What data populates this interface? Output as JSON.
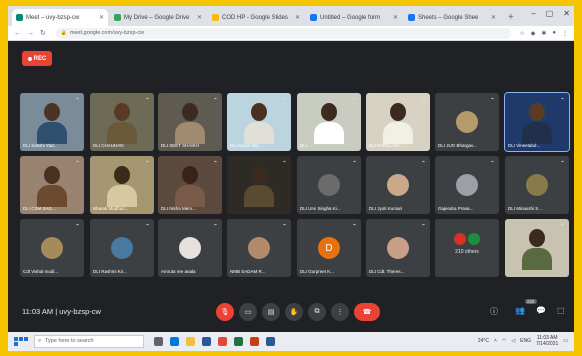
{
  "browser": {
    "tabs": [
      {
        "label": "Meet – uvy-bzsp-cw",
        "fav": "#00897b",
        "active": true
      },
      {
        "label": "My Drive – Google Drive",
        "fav": "#34a853",
        "active": false
      },
      {
        "label": "COD HP - Google Slides",
        "fav": "#fbbc04",
        "active": false
      },
      {
        "label": "Untitled – Google form",
        "fav": "#1a73e8",
        "active": false
      },
      {
        "label": "Sheets – Google Shee",
        "fav": "#1a73e8",
        "active": false
      }
    ],
    "new_tab": "+",
    "url": "meet.google.com/uvy-bzsp-cw"
  },
  "meet": {
    "rec_label": "REC",
    "tiles": [
      {
        "name": "DLI Sakshi Yad...",
        "type": "video",
        "bg": "#7a8c9a",
        "head": "#4a3426",
        "body": "#2f4f6f"
      },
      {
        "name": "DLI CHAUHAN",
        "type": "video",
        "bg": "#6d6a55",
        "head": "#5a3a24",
        "body": "#6b5a3a"
      },
      {
        "name": "DLI SEET SHAIKH",
        "type": "video",
        "bg": "#5f5a52",
        "head": "#3a2a20",
        "body": "#a08a70"
      },
      {
        "name": "DLI Karan Ma...",
        "type": "video",
        "bg": "#bcd4e0",
        "head": "#4a3020",
        "body": "#e0e0d8"
      },
      {
        "name": "DLI ...",
        "type": "video",
        "bg": "#c9ccc0",
        "head": "#3e2a1e",
        "body": "#ffffff"
      },
      {
        "name": "DLI PARUL MA...",
        "type": "video",
        "bg": "#d8d2c2",
        "head": "#3b2a1f",
        "body": "#f2efe6"
      },
      {
        "name": "DLI JUO Bhargav...",
        "type": "avatar",
        "avatar_bg": "#b59a6a",
        "initial": ""
      },
      {
        "name": "DLI Vineetabd...",
        "type": "video",
        "bg": "#1f3a6a",
        "head": "#5a3c26",
        "body": "#20304a",
        "highlight": true
      },
      {
        "name": "DLI CSM SAG...",
        "type": "video",
        "bg": "#9a8270",
        "head": "#4a3020",
        "body": "#6b4a30"
      },
      {
        "name": "Bharati Madhuri...",
        "type": "video",
        "bg": "#a59570",
        "head": "#3a2a1c",
        "body": "#d8c8a0"
      },
      {
        "name": "DLI Nisha Mem...",
        "type": "video",
        "bg": "#5d4a3e",
        "head": "#3a2218",
        "body": "#7a5a48"
      },
      {
        "name": "",
        "type": "video",
        "bg": "#2e2a26",
        "head": "#3b2a20",
        "body": "#5a4a30"
      },
      {
        "name": "DLI Urvi Singha Ki...",
        "type": "avatar",
        "avatar_bg": "#6b6b6b",
        "initial": ""
      },
      {
        "name": "DLI Jyoti Kumari",
        "type": "avatar",
        "avatar_bg": "#c9a98a",
        "initial": ""
      },
      {
        "name": "Gajendra Prasa...",
        "type": "avatar",
        "avatar_bg": "#9aa0a6",
        "initial": ""
      },
      {
        "name": "DLI Minaxshi S...",
        "type": "avatar",
        "avatar_bg": "#8a7a4a",
        "initial": ""
      },
      {
        "name": "Cdt Vishal modi...",
        "type": "avatar",
        "avatar_bg": "#a58a5a",
        "initial": ""
      },
      {
        "name": "DLI Rashmi Kir...",
        "type": "avatar",
        "avatar_bg": "#4a7aa0",
        "initial": ""
      },
      {
        "name": "Amruta ree anala",
        "type": "avatar",
        "avatar_bg": "#e8e0dc",
        "initial": ""
      },
      {
        "name": "NMB SADAM R...",
        "type": "avatar",
        "avatar_bg": "#b08a6a",
        "initial": ""
      },
      {
        "name": "DLI Gurpreet K...",
        "type": "avatar",
        "avatar_bg": "#e8710a",
        "initial": "D"
      },
      {
        "name": "DLI Cdt. Theres...",
        "type": "avatar",
        "avatar_bg": "#c8a08a",
        "initial": ""
      },
      {
        "name": "",
        "type": "others",
        "count": "210 others"
      },
      {
        "name": "",
        "type": "video",
        "bg": "#c8c2b0",
        "head": "#3b2a1e",
        "body": "#5a6a40"
      }
    ]
  },
  "controls": {
    "clock": "11:03 AM  |  uvy-bzsp-cw",
    "people_badge": "226"
  },
  "taskbar": {
    "search_placeholder": "Type here to search",
    "temp": "24°C",
    "time": "11:03 AM",
    "date": "7/14/2021",
    "lang": "ENG"
  }
}
